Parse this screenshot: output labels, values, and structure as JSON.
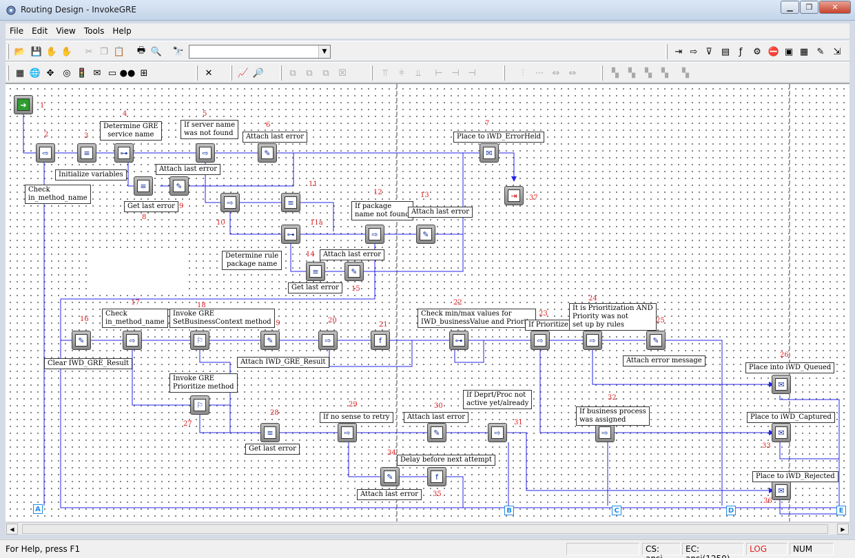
{
  "window": {
    "title": "Routing Design - InvokeGRE",
    "min_label": "▁",
    "max_label": "❐",
    "close_label": "✕"
  },
  "menu": {
    "file": "File",
    "edit": "Edit",
    "view": "View",
    "tools": "Tools",
    "help": "Help"
  },
  "toolbar": {
    "search_value": ""
  },
  "diagram": {
    "numbers": {
      "n1": "1",
      "n2": "2",
      "n3": "3",
      "n4": "4",
      "n5": "5",
      "n6": "6",
      "n7": "7",
      "n8": "8",
      "n9": "9",
      "n10": "10",
      "n11": "11",
      "n11a": "11a",
      "n12": "12",
      "n13": "13",
      "n14": "14",
      "n15": "15",
      "n16": "16",
      "n17": "17",
      "n18": "18",
      "n19": "19",
      "n20": "20",
      "n21": "21",
      "n22": "22",
      "n23": "23",
      "n24": "24",
      "n25": "25",
      "n26": "26",
      "n27": "27",
      "n28": "28",
      "n29": "29",
      "n30": "30",
      "n31": "31",
      "n32": "32",
      "n33": "33",
      "n34": "34",
      "n35": "35",
      "n36": "36",
      "n37": "37"
    },
    "labels": {
      "determine_gre": "Determine GRE\nservice name",
      "server_not_found": "If server name\nwas not found",
      "attach_last_error_6": "Attach last error",
      "place_errorheld": "Place to iWD_ErrorHeld",
      "initialize_variables": "Initialize variables",
      "attach_last_error_9": "Attach last error",
      "check_in_method": "Check\nin_method_name",
      "get_last_error_8": "Get last error",
      "if_package": "If package\nname not found",
      "attach_last_error_13": "Attach last error",
      "determine_rule_pkg": "Determine rule\npackage name",
      "attach_last_error_15": "Attach last error",
      "get_last_error_14": "Get last error",
      "check_in_method_17": "Check\nin_method_name",
      "invoke_gre_set": "Invoke GRE\nSetBusinessContext method",
      "check_minmax": "Check min/max values for\nIWD_businessValue and Priority",
      "if_prioritize": "If Prioritize",
      "prioritization_and": "It is Prioritization AND\nPriority was not\nset up by rules",
      "clear_result": "Clear IWD_GRE_Result",
      "attach_result": "Attach IWD_GRE_Result",
      "attach_error_msg": "Attach error message",
      "place_queued": "Place into iWD_Queued",
      "invoke_gre_prioritize": "Invoke GRE\nPrioritize method",
      "if_deprt": "If Deprt/Proc not\nactive yet/already",
      "if_business": "If business process\nwas assigned",
      "place_captured": "Place to iWD_Captured",
      "if_no_sense": "If no sense to retry",
      "attach_last_error_30": "Attach last error",
      "get_last_error_28": "Get last error",
      "delay_before": "Delay before next attempt",
      "attach_last_error_34": "Attach last error",
      "place_rejected": "Place to iWD_Rejected"
    },
    "connectors": {
      "a": "A",
      "b": "B",
      "c": "C",
      "d": "D",
      "e": "E"
    }
  },
  "statusbar": {
    "help_text": "For Help, press F1",
    "cs": "CS: ansi",
    "ec": "EC: ansi(1250)",
    "log": "LOG",
    "num": "NUM"
  },
  "colors": {
    "link_line": "#2323e8",
    "accent_red": "#e02020",
    "connector": "#1e8ce6"
  }
}
